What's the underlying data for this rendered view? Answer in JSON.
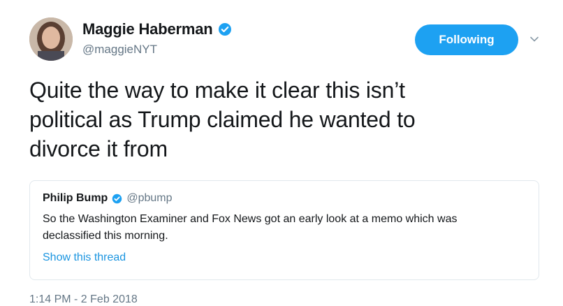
{
  "author": {
    "name": "Maggie Haberman",
    "handle": "@maggieNYT"
  },
  "follow_button": {
    "label": "Following"
  },
  "tweet": {
    "line1": "Quite the way to make it clear this isn’t",
    "line2": "political as Trump claimed he wanted to",
    "line3": "divorce it from"
  },
  "quoted_tweet": {
    "name": "Philip Bump",
    "handle": "@pbump",
    "text_line1": "So the Washington Examiner and Fox News got an early look at a memo which was",
    "text_line2": "declassified this morning.",
    "show_thread": "Show this thread"
  },
  "timestamp": "1:14 PM - 2 Feb 2018",
  "colors": {
    "accent": "#1da1f2",
    "secondary_text": "#657786",
    "link": "#1b95e0"
  },
  "icons": [
    "verified-badge-icon",
    "chevron-down-icon",
    "avatar-photo"
  ]
}
